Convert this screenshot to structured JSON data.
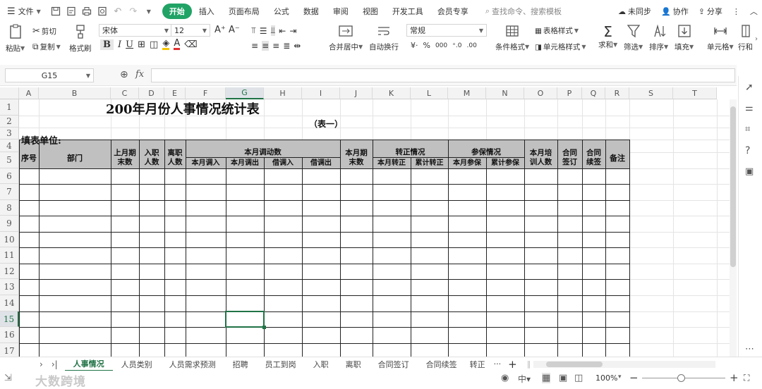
{
  "menubar": {
    "file_label": "文件",
    "tabs": [
      "开始",
      "插入",
      "页面布局",
      "公式",
      "数据",
      "审阅",
      "视图",
      "开发工具",
      "会员专享"
    ],
    "search_placeholder": "查找命令、搜索模板",
    "sync_label": "未同步",
    "collab_label": "协作",
    "share_label": "分享"
  },
  "ribbon": {
    "paste": "粘贴",
    "cut": "剪切",
    "copy": "复制",
    "format_painter": "格式刷",
    "font_name": "宋体",
    "font_size": "12",
    "merge_center": "合并居中",
    "wrap_text": "自动换行",
    "number_format": "常规",
    "cond_format": "条件格式",
    "table_style": "表格样式",
    "cell_style": "单元格样式",
    "sum": "求和",
    "filter": "筛选",
    "sort": "排序",
    "fill": "填充",
    "cell": "单元格",
    "row_col": "行和"
  },
  "formula_bar": {
    "cell_ref": "G15",
    "fx": "fx",
    "content": ""
  },
  "columns": [
    "A",
    "B",
    "C",
    "D",
    "E",
    "F",
    "G",
    "H",
    "I",
    "J",
    "K",
    "L",
    "M",
    "N",
    "O",
    "P",
    "Q",
    "R",
    "S",
    "T"
  ],
  "rows": [
    "1",
    "2",
    "3",
    "4",
    "5",
    "6",
    "7",
    "8",
    "9",
    "10",
    "11",
    "12",
    "13",
    "14",
    "15",
    "16",
    "17"
  ],
  "table": {
    "title": "200年月份人事情况统计表",
    "subtitle": "（表一）",
    "unit_label": "填表单位:",
    "h_seq": "序号",
    "h_dept": "部门",
    "h_last_end_1": "上月期",
    "h_last_end_2": "末数",
    "h_join_1": "入职",
    "h_join_2": "人数",
    "h_leave_1": "离职",
    "h_leave_2": "人数",
    "h_transfer": "本月调动数",
    "h_in": "本月调入",
    "h_out": "本月调出",
    "h_borrow_in": "借调入",
    "h_borrow_out": "借调出",
    "h_end_1": "本月期",
    "h_end_2": "末数",
    "h_regular": "转正情况",
    "h_reg_month": "本月转正",
    "h_reg_total": "累计转正",
    "h_insure": "参保情况",
    "h_ins_month": "本月参保",
    "h_ins_total": "累计参保",
    "h_train_1": "本月培",
    "h_train_2": "训人数",
    "h_contract_1": "合同",
    "h_contract_2": "签订",
    "h_renew_1": "合同",
    "h_renew_2": "续签",
    "h_note": "备注"
  },
  "sheet_tabs": [
    "人事情况",
    "人员类别",
    "人员需求预测",
    "招聘",
    "员工到岗",
    "入职",
    "离职",
    "合同签订",
    "合同续签",
    "转正"
  ],
  "status": {
    "zoom": "100%",
    "watermark": "大数跨境"
  }
}
